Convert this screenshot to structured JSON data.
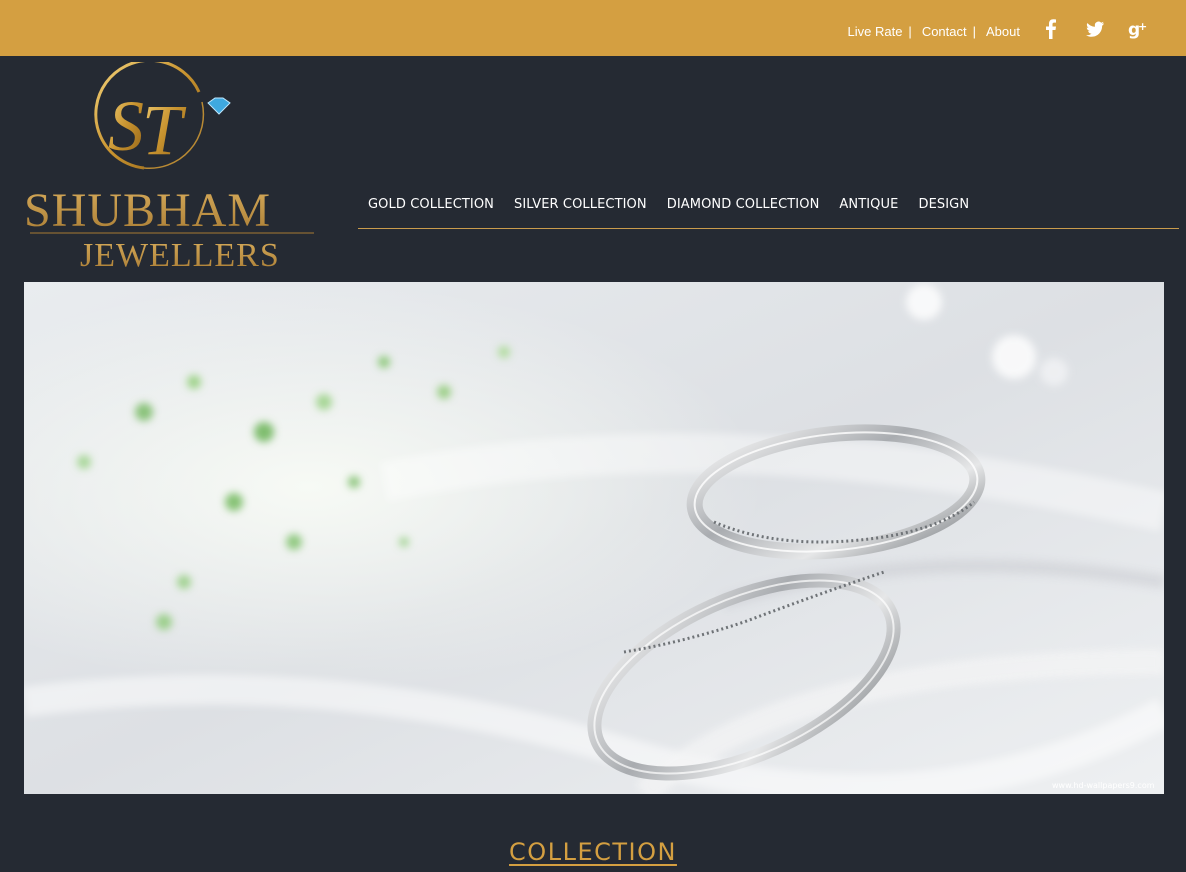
{
  "topbar": {
    "links": [
      "Live Rate",
      "Contact",
      "About"
    ],
    "separator": "|",
    "social": [
      "facebook-icon",
      "twitter-icon",
      "google-plus-icon"
    ],
    "color": "#d49f41"
  },
  "brand": {
    "name": "SHUBHAM",
    "sub": "JEWELLERS",
    "monogram": "ST"
  },
  "nav": {
    "items": [
      "GOLD COLLECTION",
      "SILVER COLLECTION",
      "DIAMOND COLLECTION",
      "ANTIQUE",
      "DESIGN"
    ]
  },
  "hero": {
    "image": "silver-wedding-rings",
    "watermark": "www.hd-wallpapers9.com"
  },
  "section": {
    "title": "COLLECTION"
  },
  "colors": {
    "background": "#252a33",
    "accent": "#d49f41",
    "text": "#ffffff"
  }
}
